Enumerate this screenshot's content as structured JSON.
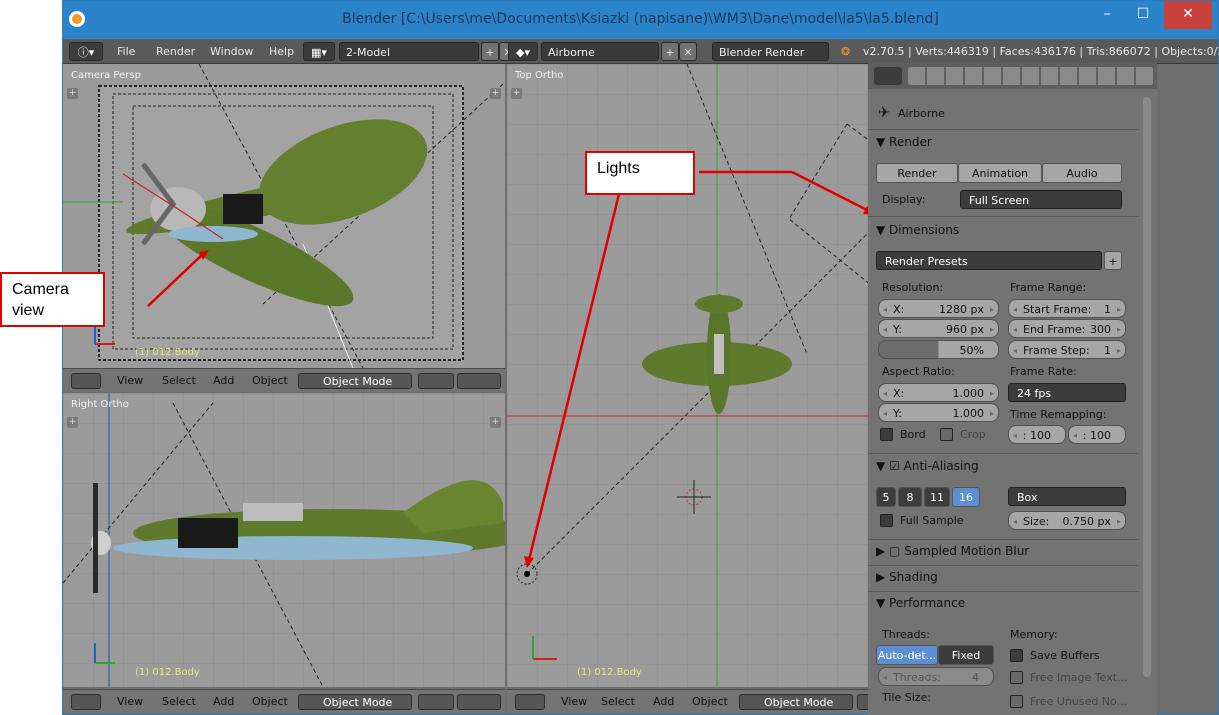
{
  "window": {
    "title": "Blender [C:\\Users\\me\\Documents\\Ksiazki (napisane)\\WM3\\Dane\\model\\la5\\la5.blend]",
    "minimize": "–",
    "maximize": "☐",
    "close": "✕"
  },
  "infobar": {
    "menus": [
      "File",
      "Render",
      "Window",
      "Help"
    ],
    "layout": "2-Model",
    "scene": "Airborne",
    "engine": "Blender Render",
    "stats": "v2.70.5 | Verts:446319 | Faces:436176 | Tris:866072 | Objects:0/35"
  },
  "viewports": {
    "camera": {
      "label": "Camera Persp",
      "object": "(1) 012.Body"
    },
    "right": {
      "label": "Right Ortho",
      "object": "(1) 012.Body"
    },
    "top": {
      "label": "Top Ortho",
      "object": "(1) 012.Body"
    },
    "footer": {
      "view": "View",
      "select": "Select",
      "add": "Add",
      "object": "Object",
      "mode": "Object Mode"
    }
  },
  "annotations": {
    "camera": [
      "Camera",
      "view"
    ],
    "lights": "Lights"
  },
  "properties": {
    "scene_name": "Airborne",
    "render": {
      "title": "Render",
      "buttons": [
        "Render",
        "Animation",
        "Audio"
      ],
      "display_label": "Display:",
      "display_value": "Full Screen"
    },
    "dimensions": {
      "title": "Dimensions",
      "presets": "Render Presets",
      "resolution_label": "Resolution:",
      "res_x_label": "X:",
      "res_x": "1280 px",
      "res_y_label": "Y:",
      "res_y": "960 px",
      "res_pct": "50%",
      "frame_range_label": "Frame Range:",
      "start_label": "Start Frame:",
      "start": "1",
      "end_label": "End Frame:",
      "end": "300",
      "step_label": "Frame Step:",
      "step": "1",
      "aspect_label": "Aspect Ratio:",
      "asp_x_label": "X:",
      "asp_x": "1.000",
      "asp_y_label": "Y:",
      "asp_y": "1.000",
      "frame_rate_label": "Frame Rate:",
      "frame_rate": "24 fps",
      "time_remap_label": "Time Remapping:",
      "remap_old": ": 100",
      "remap_new": ": 100",
      "bord": "Bord",
      "crop": "Crop"
    },
    "anti_aliasing": {
      "title": "Anti-Aliasing",
      "samples": [
        "5",
        "8",
        "11",
        "16"
      ],
      "filter": "Box",
      "full_sample": "Full Sample",
      "size_label": "Size:",
      "size": "0.750 px"
    },
    "motion_blur": {
      "title": "Sampled Motion Blur"
    },
    "shading": {
      "title": "Shading"
    },
    "performance": {
      "title": "Performance",
      "threads_label": "Threads:",
      "auto": "Auto-det...",
      "fixed": "Fixed",
      "threads_field_label": "Threads:",
      "threads_value": "4",
      "tile_label": "Tile Size:",
      "memory_label": "Memory:",
      "save_buffers": "Save Buffers",
      "free_image": "Free Image Text...",
      "free_unused": "Free Unused No..."
    }
  },
  "colors": {
    "titlebar": "#2b84c9",
    "panel": "#737373",
    "viewport": "#9b9b9b",
    "annotation_red": "#e00000",
    "aa_selected": "#5b8fd4"
  }
}
